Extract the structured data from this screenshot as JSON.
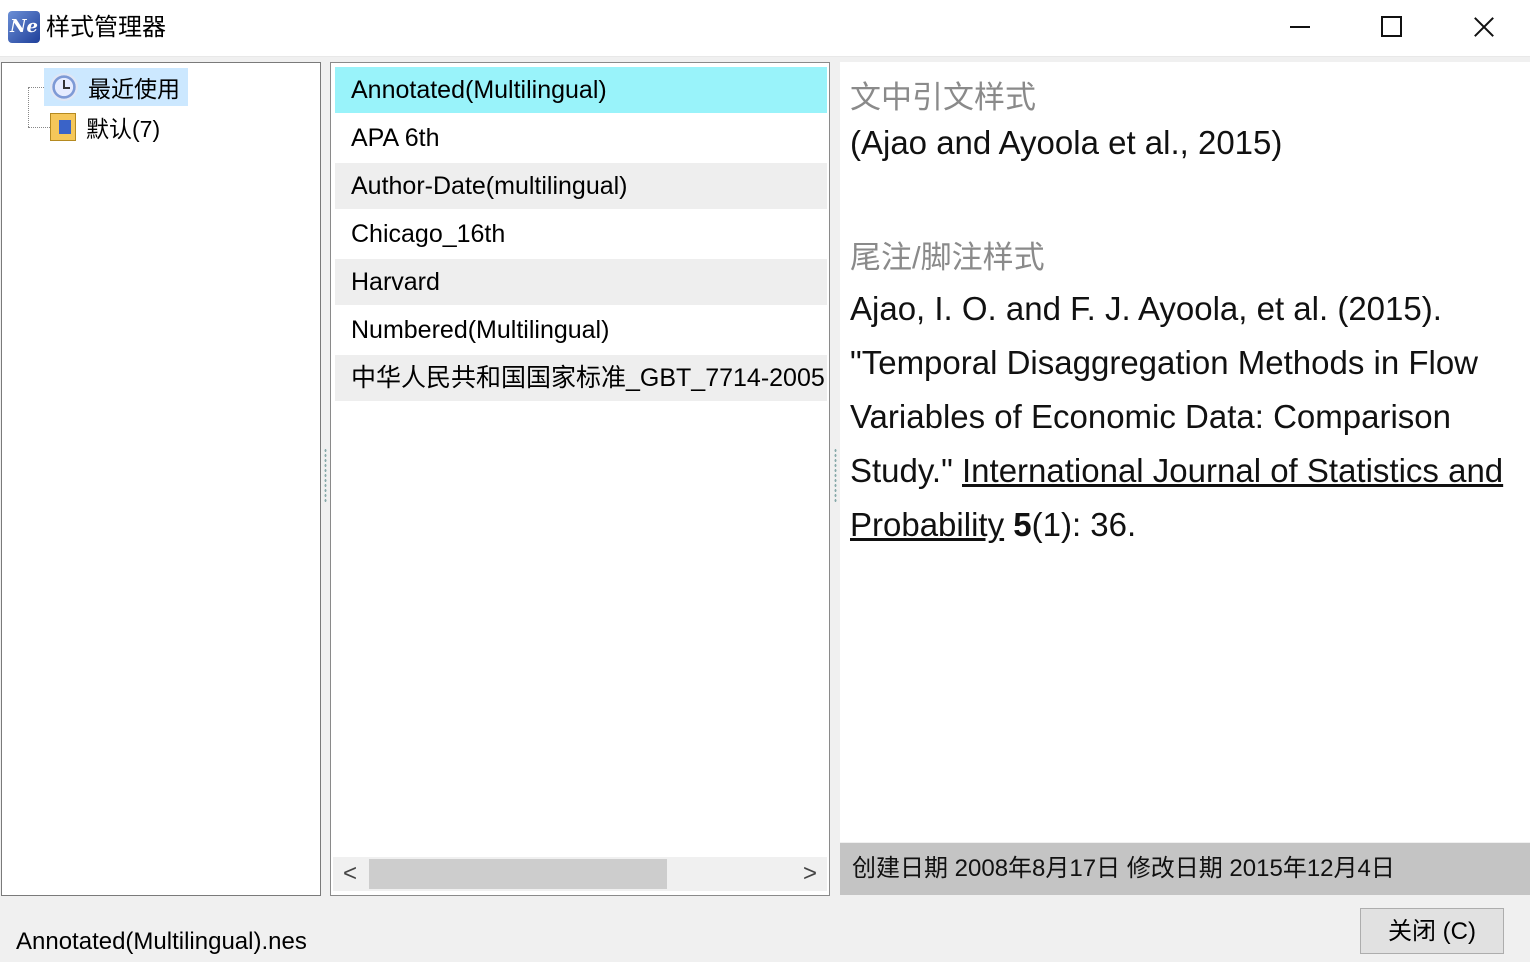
{
  "window": {
    "title": "样式管理器",
    "app_icon_text": "Ne"
  },
  "tree": {
    "items": [
      {
        "label": "最近使用",
        "icon": "clock-icon",
        "selected": true
      },
      {
        "label": "默认(7)",
        "icon": "folder-icon",
        "selected": false
      }
    ]
  },
  "styles_list": {
    "items": [
      {
        "label": "Annotated(Multilingual)",
        "selected": true
      },
      {
        "label": "APA 6th"
      },
      {
        "label": "Author-Date(multilingual)"
      },
      {
        "label": "Chicago_16th"
      },
      {
        "label": "Harvard"
      },
      {
        "label": "Numbered(Multilingual)"
      },
      {
        "label": "中华人民共和国国家标准_GBT_7714-2005"
      }
    ],
    "scroll_left": "<",
    "scroll_right": ">"
  },
  "preview": {
    "citation_label": "文中引文样式",
    "citation_text": "(Ajao and Ayoola et al., 2015)",
    "note_label": "尾注/脚注样式",
    "reference": {
      "prefix": "Ajao, I. O. and F. J. Ayoola, et al. (2015). \"Temporal Disaggregation Methods in Flow Variables of Economic Data: Comparison Study.\" ",
      "journal": "International Journal of Statistics and Probability",
      "volume": "5",
      "suffix": "(1): 36."
    }
  },
  "dates": {
    "text": "创建日期  2008年8月17日  修改日期  2015年12月4日"
  },
  "footer": {
    "file_name": "Annotated(Multilingual).nes",
    "close_label": "关闭 (C)"
  },
  "colors": {
    "selected_style": "#99f3fa",
    "selected_tree": "#cce8ff",
    "date_bar": "#c4c4c4"
  }
}
